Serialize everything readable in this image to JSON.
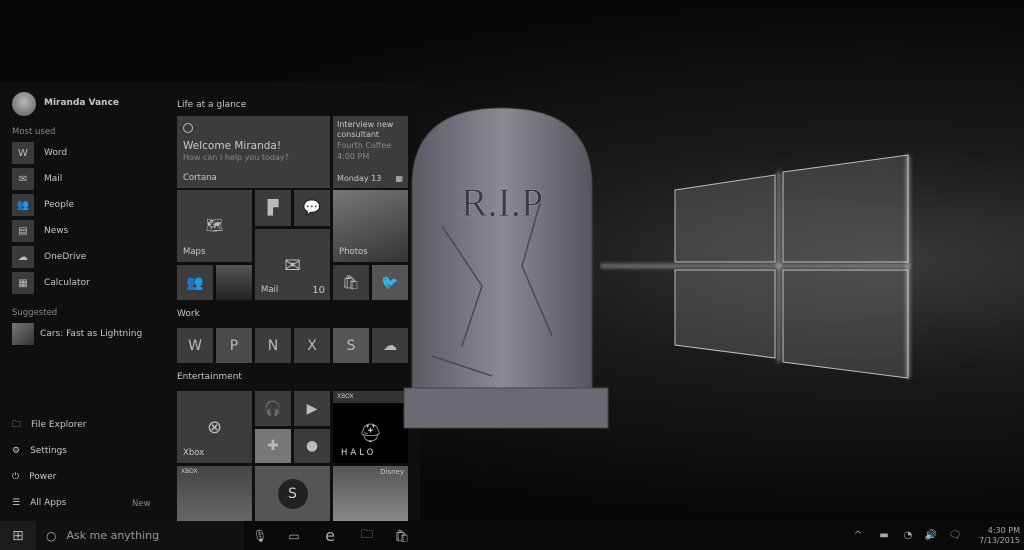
{
  "user": {
    "name": "Miranda Vance"
  },
  "most_used": {
    "title": "Most used",
    "items": [
      {
        "label": "Word",
        "icon": "word-icon"
      },
      {
        "label": "Mail",
        "icon": "mail-icon"
      },
      {
        "label": "People",
        "icon": "people-icon"
      },
      {
        "label": "News",
        "icon": "news-icon"
      },
      {
        "label": "OneDrive",
        "icon": "onedrive-icon"
      },
      {
        "label": "Calculator",
        "icon": "calculator-icon"
      }
    ]
  },
  "suggested": {
    "title": "Suggested",
    "item": "Cars: Fast as Lightning"
  },
  "bottom": {
    "file_explorer": "File Explorer",
    "settings": "Settings",
    "power": "Power",
    "all_apps": "All Apps",
    "new_badge": "New"
  },
  "groups": {
    "life": "Life at a glance",
    "work": "Work",
    "entertainment": "Entertainment"
  },
  "tiles": {
    "cortana": {
      "title": "Welcome Miranda!",
      "subtitle": "How can I help you today?",
      "label": "Cortana"
    },
    "calendar": {
      "line1": "Interview new consultant",
      "line2": "Fourth Coffee",
      "line3": "4:00 PM",
      "date": "Monday 13"
    },
    "maps": "Maps",
    "photos": "Photos",
    "mail": "Mail",
    "mail_count": "10",
    "xbox": "Xbox",
    "xbox_badge": "XBOX",
    "halo": "HALO",
    "disney": "Disney"
  },
  "tombstone": {
    "text": "R.I.P"
  },
  "taskbar": {
    "search_placeholder": "Ask me anything",
    "time": "4:30 PM",
    "date": "7/13/2015"
  }
}
